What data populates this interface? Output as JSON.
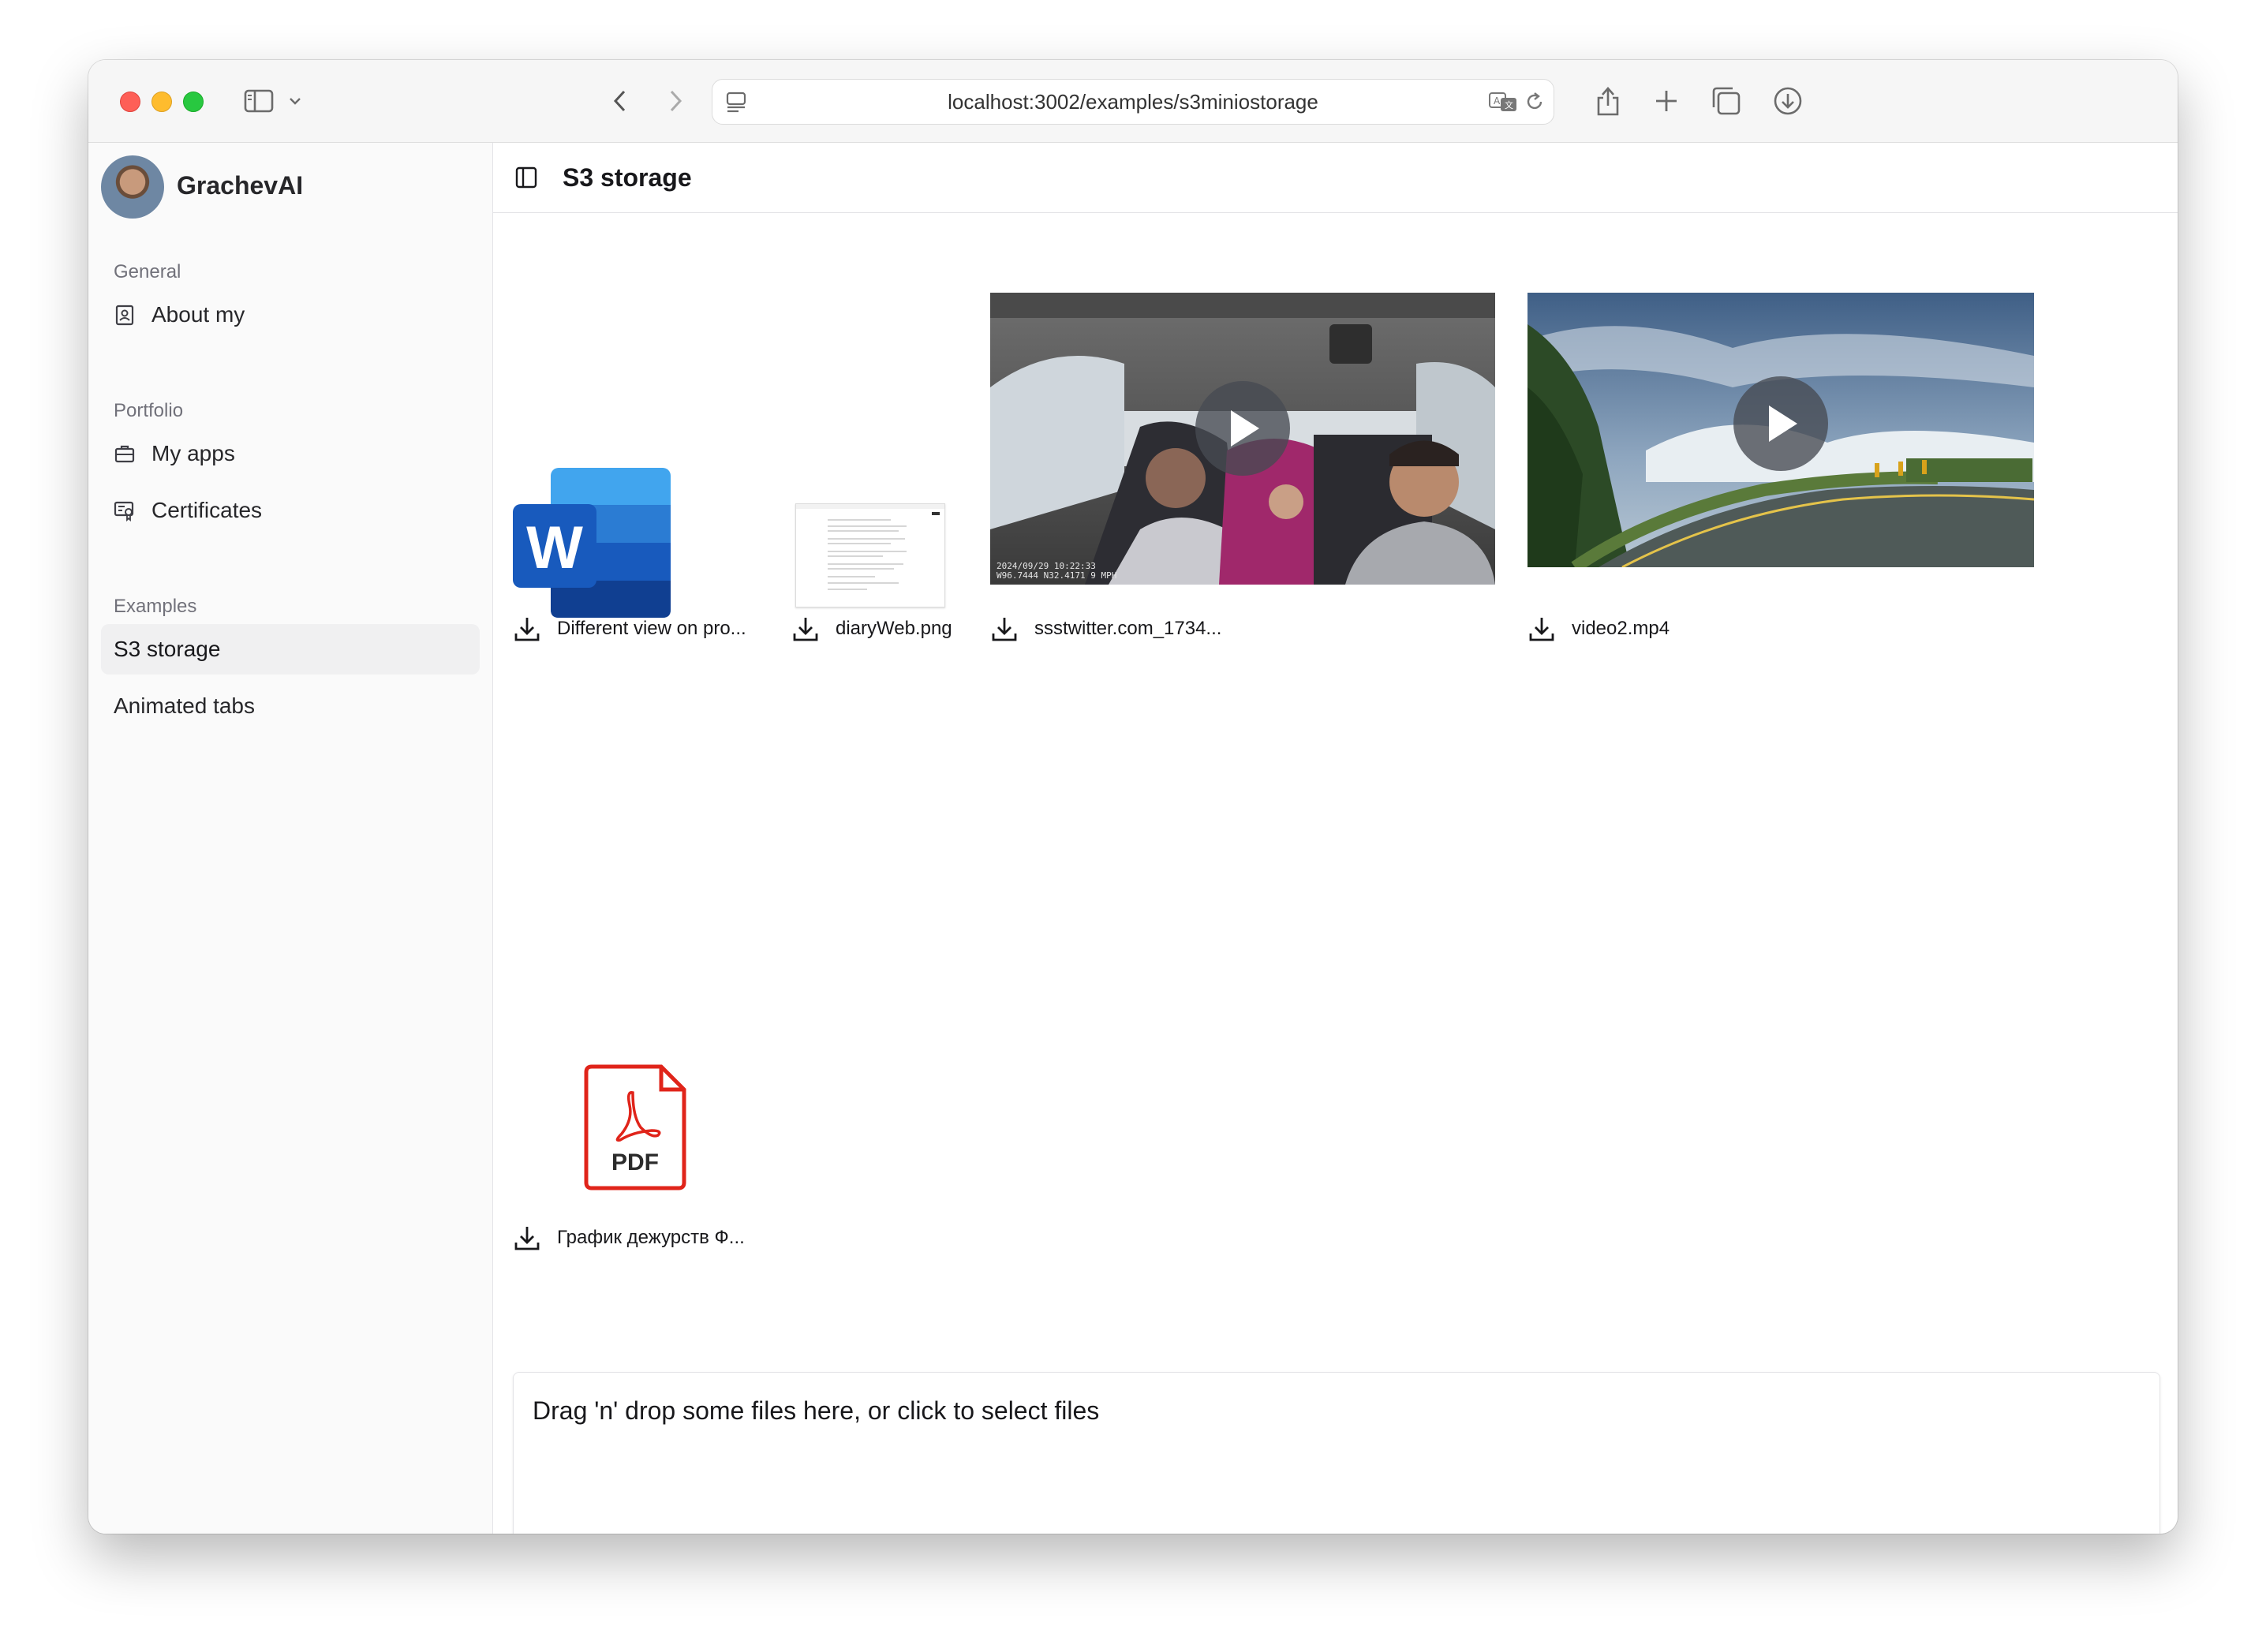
{
  "browser": {
    "url": "localhost:3002/examples/s3miniostorage"
  },
  "sidebar": {
    "brand": "GrachevAI",
    "sections": [
      {
        "label": "General"
      },
      {
        "label": "Portfolio"
      },
      {
        "label": "Examples"
      }
    ],
    "items": {
      "about": "About my",
      "my_apps": "My apps",
      "certificates": "Certificates",
      "s3_storage": "S3 storage",
      "animated_tabs": "Animated tabs"
    },
    "active_item": "S3 storage"
  },
  "main": {
    "title": "S3 storage",
    "files": [
      {
        "name": "Different view on pro...",
        "kind": "word-document-icon"
      },
      {
        "name": "diaryWeb.png",
        "kind": "image-thumbnail"
      },
      {
        "name": "ssstwitter.com_1734...",
        "kind": "video"
      },
      {
        "name": "video2.mp4",
        "kind": "video"
      },
      {
        "name": "График дежурств Ф...",
        "kind": "pdf-icon"
      }
    ],
    "pdf_badge": "PDF",
    "word_letter": "W",
    "dropzone_text": "Drag 'n' drop some files here, or click to select files"
  },
  "colors": {
    "accent_pdf": "#e0241a",
    "word_blue": "#185abd",
    "active_bg": "#f0f0f1"
  }
}
